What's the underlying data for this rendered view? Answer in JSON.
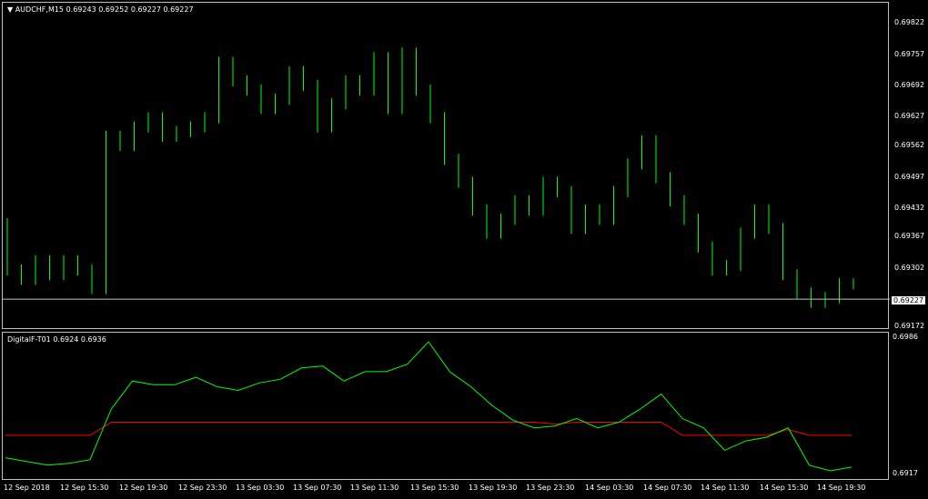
{
  "main_chart": {
    "title": "AUDCHF,M15",
    "ohlc": "0.69243 0.69252 0.69227 0.69227",
    "price_labels": [
      "0.69822",
      "0.69757",
      "0.69692",
      "0.69627",
      "0.69562",
      "0.69497",
      "0.69432",
      "0.69367",
      "0.69302",
      "0.69172"
    ],
    "current_price": "0.69227",
    "colors": {
      "bars": "#00ff00",
      "background": "#000000",
      "grid": "#c0c0c0"
    }
  },
  "indicator": {
    "title": "DigitalF-T01",
    "values": "0.6924 0.6936",
    "scale_top": "0.6986",
    "scale_bottom": "0.6917",
    "colors": {
      "fast": "#00ff00",
      "slow": "#ff0000"
    }
  },
  "time_axis": {
    "labels": [
      "12 Sep 2018",
      "12 Sep 15:30",
      "12 Sep 19:30",
      "12 Sep 23:30",
      "13 Sep 03:30",
      "13 Sep 07:30",
      "13 Sep 11:30",
      "13 Sep 15:30",
      "13 Sep 19:30",
      "13 Sep 23:30",
      "14 Sep 03:30",
      "14 Sep 07:30",
      "14 Sep 11:30",
      "14 Sep 15:30",
      "14 Sep 19:30"
    ]
  },
  "chart_data": {
    "type": "line",
    "series": [
      {
        "name": "AUDCHF,M15",
        "values": [
          0.6939,
          0.6929,
          0.6927,
          0.6931,
          0.6928,
          0.6931,
          0.6929,
          0.6925,
          0.6958,
          0.6956,
          0.696,
          0.6962,
          0.6958,
          0.6959,
          0.696,
          0.6962,
          0.6974,
          0.697,
          0.6968,
          0.6964,
          0.6966,
          0.6972,
          0.6969,
          0.696,
          0.6965,
          0.697,
          0.6968,
          0.6975,
          0.6964,
          0.6976,
          0.6968,
          0.6962,
          0.6953,
          0.6948,
          0.6942,
          0.6937,
          0.694,
          0.6944,
          0.6942,
          0.6948,
          0.6946,
          0.6938,
          0.6942,
          0.694,
          0.6946,
          0.6952,
          0.6957,
          0.6949,
          0.6944,
          0.694,
          0.6934,
          0.6929,
          0.693,
          0.6937,
          0.6942,
          0.6938,
          0.6928,
          0.6924,
          0.6922,
          0.6923,
          0.6926
        ]
      },
      {
        "name": "DigitalF-T01",
        "values": [
          0.6924,
          0.6922,
          0.692,
          0.6921,
          0.6923,
          0.695,
          0.6965,
          0.6963,
          0.6963,
          0.6967,
          0.6962,
          0.696,
          0.6964,
          0.6966,
          0.6972,
          0.6973,
          0.6965,
          0.697,
          0.697,
          0.6974,
          0.6986,
          0.697,
          0.6962,
          0.6952,
          0.6944,
          0.694,
          0.6941,
          0.6945,
          0.694,
          0.6943,
          0.695,
          0.6958,
          0.6945,
          0.694,
          0.6928,
          0.6933,
          0.6935,
          0.694,
          0.692,
          0.6917,
          0.6919
        ]
      },
      {
        "name": "signal",
        "values": [
          0.6936,
          0.6936,
          0.6936,
          0.6936,
          0.6936,
          0.6943,
          0.6943,
          0.6943,
          0.6943,
          0.6943,
          0.6943,
          0.6943,
          0.6943,
          0.6943,
          0.6943,
          0.6943,
          0.6943,
          0.6943,
          0.6943,
          0.6943,
          0.6943,
          0.6943,
          0.6943,
          0.6943,
          0.6943,
          0.6943,
          0.6942,
          0.6943,
          0.6943,
          0.6943,
          0.6943,
          0.6943,
          0.6936,
          0.6936,
          0.6936,
          0.6936,
          0.6936,
          0.6939,
          0.6936,
          0.6936,
          0.6936
        ]
      }
    ]
  }
}
